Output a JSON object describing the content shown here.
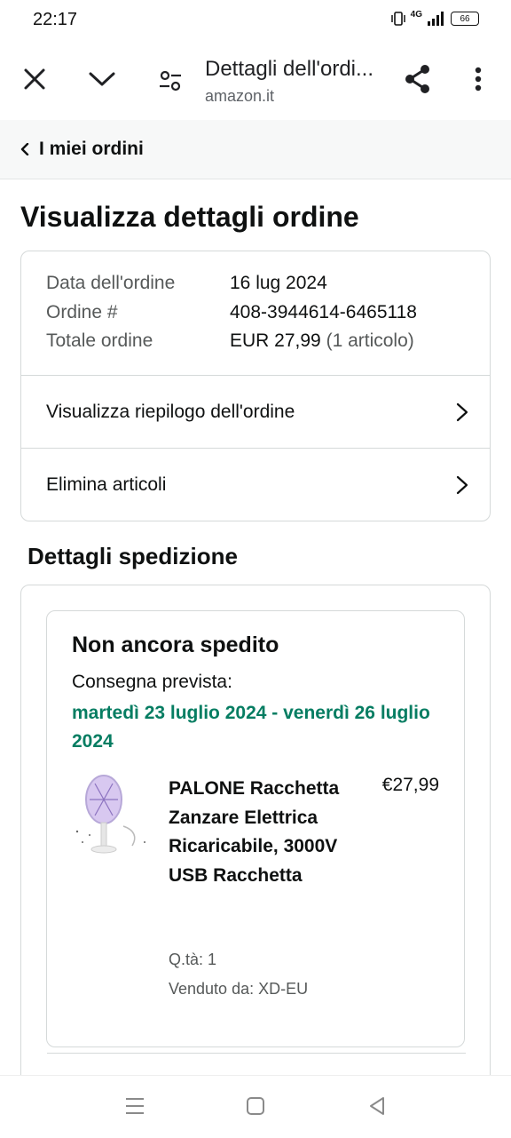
{
  "status": {
    "time": "22:17",
    "network": "4G",
    "battery": "66"
  },
  "browser": {
    "page_title": "Dettagli dell'ordi...",
    "url": "amazon.it"
  },
  "breadcrumb": {
    "label": "I miei ordini"
  },
  "page": {
    "title": "Visualizza dettagli ordine"
  },
  "summary": {
    "date_label": "Data dell'ordine",
    "date_value": "16 lug 2024",
    "order_label": "Ordine #",
    "order_value": "408-3944614-6465118",
    "total_label": "Totale ordine",
    "total_value": "EUR 27,99",
    "total_items": "(1 articolo)",
    "link_summary": "Visualizza riepilogo dell'ordine",
    "link_delete": "Elimina articoli"
  },
  "shipping": {
    "section_title": "Dettagli spedizione",
    "status": "Non ancora spedito",
    "delivery_label": "Consegna prevista:",
    "delivery_date": "martedì 23 luglio 2024 - venerdì 26 luglio 2024",
    "product": {
      "title": "PALONE Racchetta Zanzare Elettrica Ricaricabile, 3000V USB Racchetta",
      "price": "€27,99",
      "qty": "Q.tà: 1",
      "seller": "Venduto da: XD-EU"
    }
  },
  "colors": {
    "delivery_green": "#067d62",
    "border": "#d5d9d9"
  },
  "icons": [
    "close-icon",
    "chevron-down-icon",
    "page-settings-icon",
    "share-icon",
    "more-vert-icon",
    "chevron-left-icon",
    "chevron-right-icon",
    "menu-icon",
    "home-icon",
    "back-icon"
  ]
}
